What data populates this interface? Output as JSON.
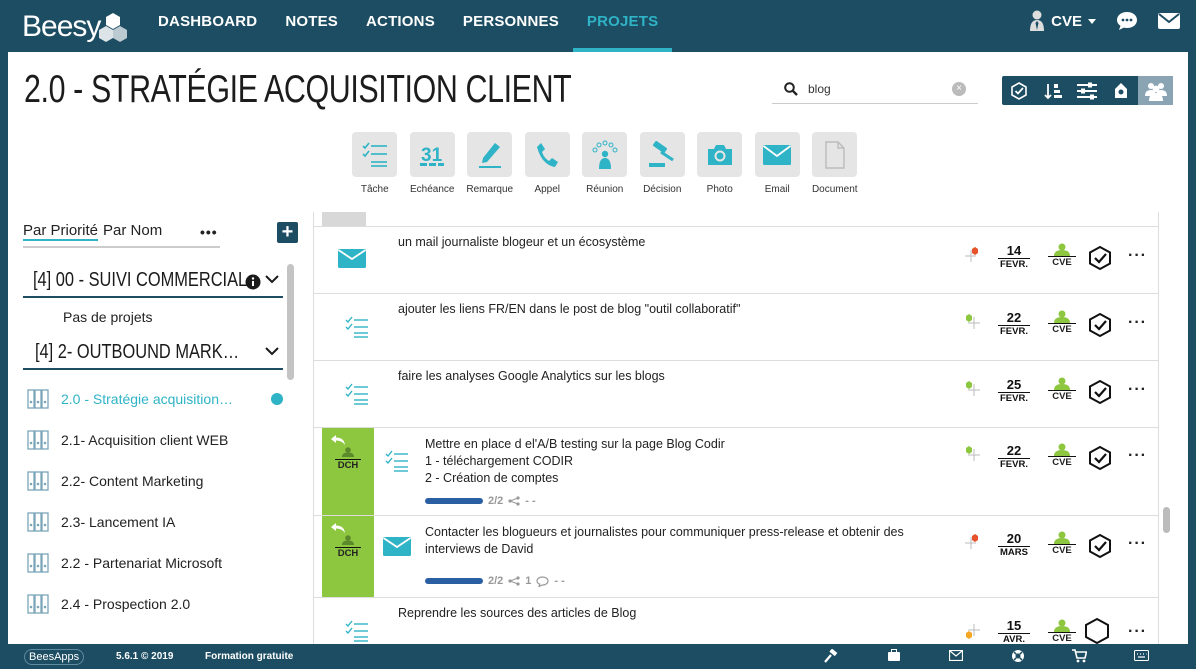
{
  "brand": "Beesy",
  "nav": {
    "items": [
      "DASHBOARD",
      "NOTES",
      "ACTIONS",
      "PERSONNES",
      "PROJETS"
    ],
    "active_index": 4,
    "user": "CVE"
  },
  "page": {
    "title": "2.0 - STRATÉGIE ACQUISITION CLIENT",
    "search_value": "blog"
  },
  "creators": [
    {
      "label": "Tâche",
      "icon": "task-icon"
    },
    {
      "label": "Echéance",
      "icon": "calendar-icon"
    },
    {
      "label": "Remarque",
      "icon": "pen-icon"
    },
    {
      "label": "Appel",
      "icon": "phone-icon"
    },
    {
      "label": "Réunion",
      "icon": "meeting-icon"
    },
    {
      "label": "Décision",
      "icon": "gavel-icon"
    },
    {
      "label": "Photo",
      "icon": "camera-icon"
    },
    {
      "label": "Email",
      "icon": "email-icon"
    },
    {
      "label": "Document",
      "icon": "document-icon"
    }
  ],
  "sidebar": {
    "sort_priority": "Par Priorité",
    "sort_name": "Par Nom",
    "more": "•••",
    "groups": [
      {
        "label": "[4] 00 - SUIVI COMMERCIAL",
        "empty_text": "Pas de projets"
      },
      {
        "label": "[4] 2- OUTBOUND MARK…"
      }
    ],
    "projects": [
      "2.0 - Stratégie acquisition…",
      "2.1- Acquisition client WEB",
      "2.2- Content Marketing",
      "2.3- Lancement IA",
      "2.2 - Partenariat Microsoft",
      "2.4 - Prospection 2.0"
    ],
    "active_project_index": 0
  },
  "rows": [
    {
      "type": "email-icon",
      "text": [
        "un mail journaliste blogeur et un écosystème"
      ],
      "priority": "high",
      "day": "14",
      "month": "FEVR.",
      "owner": "CVE"
    },
    {
      "type": "task-icon",
      "text": [
        "ajouter les liens FR/EN dans le post de blog \"outil collaboratif\""
      ],
      "priority": "low",
      "day": "22",
      "month": "FEVR.",
      "owner": "CVE"
    },
    {
      "type": "task-icon",
      "text": [
        "faire les analyses Google Analytics sur les blogs"
      ],
      "priority": "low",
      "day": "25",
      "month": "FEVR.",
      "owner": "CVE"
    },
    {
      "type": "task-icon",
      "delegate": "DCH",
      "text": [
        "Mettre en place d el'A/B testing sur la page Blog Codir",
        "1 - téléchargement CODIR",
        "2 - Création de comptes"
      ],
      "progress": "2/2",
      "progress_extra": "- -",
      "priority": "low",
      "day": "22",
      "month": "FEVR.",
      "owner": "CVE"
    },
    {
      "type": "email-icon",
      "delegate": "DCH",
      "text": [
        "Contacter les blogueurs et journalistes pour communiquer press-release et obtenir des",
        "interviews de David"
      ],
      "progress": "2/2",
      "progress_extra": "1",
      "progress_tail": "- -",
      "priority": "high",
      "day": "20",
      "month": "MARS",
      "owner": "CVE"
    },
    {
      "type": "task-icon",
      "text": [
        "Reprendre les sources des articles de Blog"
      ],
      "priority": "medium",
      "day": "15",
      "month": "AVR.",
      "owner": "CVE"
    }
  ],
  "footer": {
    "brand": "BeesApps",
    "version": "5.6.1 © 2019",
    "training": "Formation gratuite"
  },
  "colors": {
    "navy": "#1d4d62",
    "teal": "#2fb3c6",
    "green": "#8dc63f",
    "priority_high": "#e8522a",
    "priority_low": "#8dc63f",
    "priority_medium": "#f5a623"
  }
}
